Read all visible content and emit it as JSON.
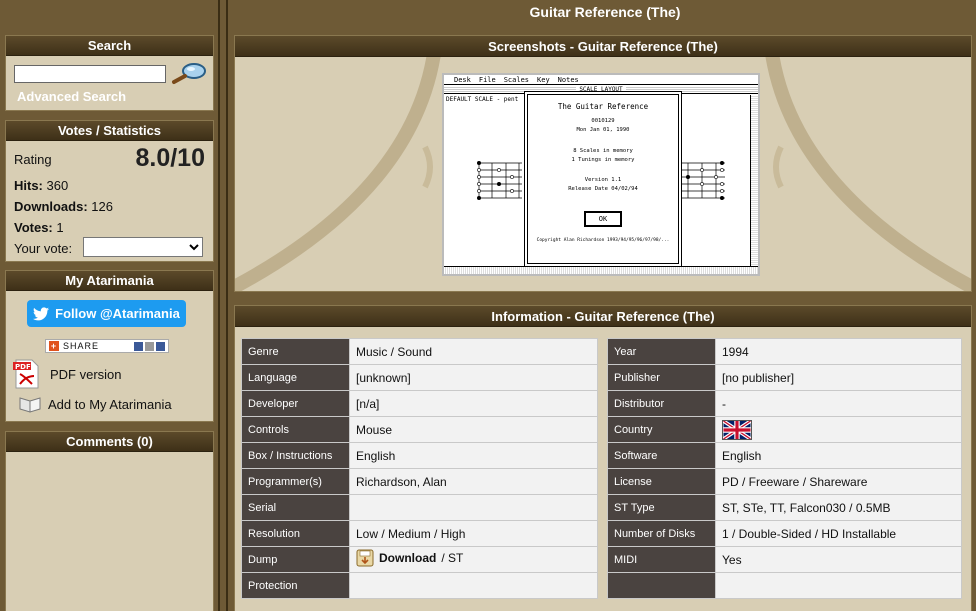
{
  "page": {
    "title": "Guitar Reference (The)"
  },
  "search": {
    "heading": "Search",
    "placeholder": "",
    "advanced_label": "Advanced Search"
  },
  "stats": {
    "heading": "Votes / Statistics",
    "rating_label": "Rating",
    "rating_value": "8.0/10",
    "hits_label": "Hits:",
    "hits_value": "360",
    "downloads_label": "Downloads:",
    "downloads_value": "126",
    "votes_label": "Votes:",
    "votes_value": "1",
    "your_vote_label": "Your vote:",
    "your_vote_selected": ""
  },
  "my": {
    "heading": "My Atarimania",
    "follow_label": "Follow @Atarimania",
    "share_label": "SHARE",
    "pdf_label": "PDF version",
    "add_label": "Add to My Atarimania"
  },
  "comments": {
    "heading": "Comments (0)"
  },
  "screenshots": {
    "heading": "Screenshots - Guitar Reference (The)",
    "menu": [
      "Desk",
      "File",
      "Scales",
      "Key",
      "Notes"
    ],
    "window_title": "SCALE LAYOUT",
    "scale_text": "DEFAULT SCALE - pent",
    "dialog_title": "The Guitar Reference",
    "dialog_line1": "0010129",
    "dialog_line2": "Mon Jan 01, 1990",
    "dialog_line3": "8 Scales in memory",
    "dialog_line4": "1 Tunings in memory",
    "dialog_line5": "Version      1.1",
    "dialog_line6": "Release Date 04/02/94",
    "ok_label": "OK",
    "copyright": "Copyright Alan Richardson 1993/94/95/96/97/98/..."
  },
  "info": {
    "heading": "Information - Guitar Reference (The)",
    "left": [
      {
        "k": "Genre",
        "v": "Music / Sound"
      },
      {
        "k": "Language",
        "v": "[unknown]"
      },
      {
        "k": "Developer",
        "v": "[n/a]"
      },
      {
        "k": "Controls",
        "v": "Mouse"
      },
      {
        "k": "Box / Instructions",
        "v": "English"
      },
      {
        "k": "Programmer(s)",
        "v": "Richardson, Alan"
      },
      {
        "k": "Serial",
        "v": ""
      },
      {
        "k": "Resolution",
        "v": "Low / Medium / High"
      },
      {
        "k": "Dump",
        "v": ""
      },
      {
        "k": "Protection",
        "v": ""
      }
    ],
    "dump_download": "Download",
    "dump_format": " / ST",
    "right": [
      {
        "k": "Year",
        "v": "1994"
      },
      {
        "k": "Publisher",
        "v": "[no publisher]"
      },
      {
        "k": "Distributor",
        "v": "-"
      },
      {
        "k": "Country",
        "v": ""
      },
      {
        "k": "Software",
        "v": "English"
      },
      {
        "k": "License",
        "v": "PD / Freeware / Shareware"
      },
      {
        "k": "ST Type",
        "v": "ST, STe, TT, Falcon030 / 0.5MB"
      },
      {
        "k": "Number of Disks",
        "v": "1 / Double-Sided / HD Installable"
      },
      {
        "k": "MIDI",
        "v": "Yes"
      },
      {
        "k": "",
        "v": ""
      }
    ]
  },
  "colors": {
    "frame": "#6e5a36",
    "panel": "#d8ceb4",
    "header": "#4a3a1e",
    "label_cell": "#4a4340",
    "twitter": "#1d9bf0"
  }
}
